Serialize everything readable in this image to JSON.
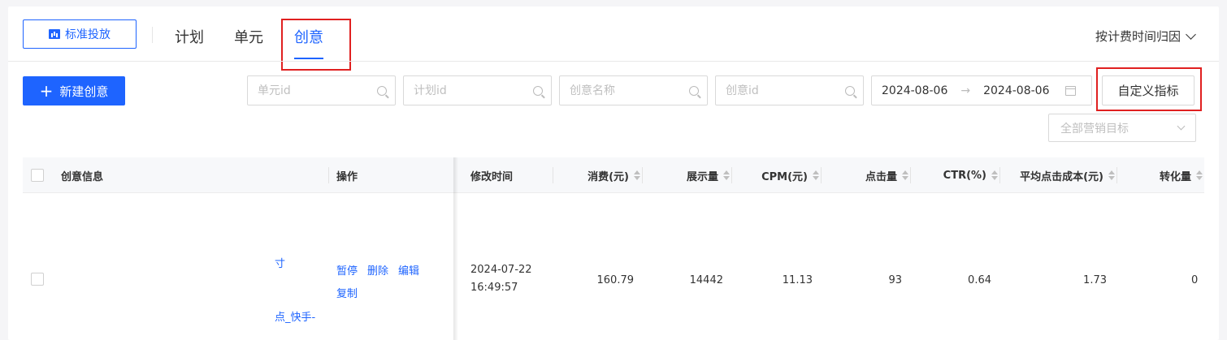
{
  "header": {
    "mode_button": "标准投放",
    "tabs": [
      "计划",
      "单元",
      "创意"
    ],
    "active_tab": "创意",
    "attribution_select": "按计费时间归因"
  },
  "toolbar": {
    "new_button": "新建创意",
    "search_placeholders": [
      "单元id",
      "计划id",
      "创意名称",
      "创意id"
    ],
    "date_start": "2024-08-06",
    "date_end": "2024-08-06",
    "custom_metrics_button": "自定义指标",
    "goal_select_placeholder": "全部营销目标"
  },
  "table": {
    "columns": [
      "创意信息",
      "操作",
      "修改时间",
      "消费(元)",
      "展示量",
      "CPM(元)",
      "点击量",
      "CTR(%)",
      "平均点击成本(元)",
      "转化量"
    ],
    "row": {
      "creative_fragment_1": "寸",
      "creative_fragment_2": "点_快手-",
      "actions": [
        "暂停",
        "删除",
        "编辑",
        "复制"
      ],
      "modified_date": "2024-07-22",
      "modified_time": "16:49:57",
      "spend": "160.79",
      "impressions": "14442",
      "cpm": "11.13",
      "clicks": "93",
      "ctr": "0.64",
      "avg_cpc": "1.73",
      "conversions": "0"
    }
  },
  "colors": {
    "primary": "#1e64ff",
    "highlight_box": "#e02020"
  }
}
